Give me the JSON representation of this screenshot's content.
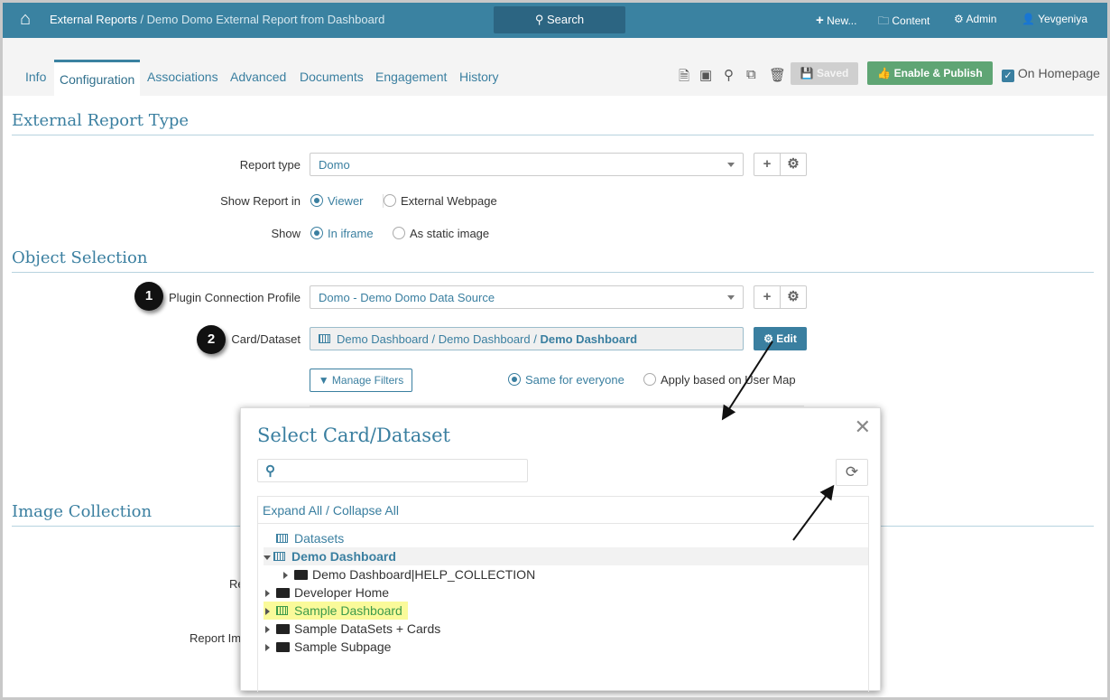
{
  "header": {
    "breadcrumb_root": "External Reports",
    "breadcrumb_sep": " / ",
    "breadcrumb_current": "Demo Domo External Report from Dashboard",
    "search_label": "Search",
    "new_label": "New...",
    "content_label": "Content",
    "admin_label": "Admin",
    "user_label": "Yevgeniya"
  },
  "tabs": [
    "Info",
    "Configuration",
    "Associations",
    "Advanced",
    "Documents",
    "Engagement",
    "History"
  ],
  "toolbar": {
    "saved_label": "Saved",
    "publish_label": "Enable & Publish",
    "homepage_label": "On Homepage"
  },
  "sections": {
    "report_type": "External Report Type",
    "object_selection": "Object Selection",
    "image_collection": "Image Collection"
  },
  "form": {
    "report_type_label": "Report type",
    "report_type_value": "Domo",
    "show_in_label": "Show Report in",
    "show_in_options": [
      "Viewer",
      "External Webpage"
    ],
    "show_label": "Show",
    "show_options": [
      "In iframe",
      "As static image"
    ],
    "plugin_label": "Plugin Connection Profile",
    "plugin_value": "Domo - Demo Domo Data Source",
    "card_label": "Card/Dataset",
    "card_path": "Demo Dashboard / Demo Dashboard / ",
    "card_name": "Demo Dashboard",
    "edit_label": "Edit",
    "manage_filters_label": "Manage Filters",
    "filter_options": [
      "Same for everyone",
      "Apply based on User Map"
    ],
    "partial_label_1": "Re",
    "partial_label_2": "Report Im"
  },
  "badges": [
    "1",
    "2"
  ],
  "modal": {
    "title": "Select Card/Dataset",
    "search_placeholder": "",
    "expand_all": "Expand All",
    "collapse_sep": " / ",
    "collapse_all": "Collapse All",
    "tree": [
      {
        "label": "Datasets"
      },
      {
        "label": "Demo Dashboard"
      },
      {
        "label": "Demo Dashboard|HELP_COLLECTION"
      },
      {
        "label": "Developer Home"
      },
      {
        "label": "Sample Dashboard"
      },
      {
        "label": "Sample DataSets + Cards"
      },
      {
        "label": "Sample Subpage"
      }
    ]
  },
  "colors": {
    "primary": "#3a82a1",
    "publish": "#5fa574",
    "highlight": "#fafa9a"
  }
}
